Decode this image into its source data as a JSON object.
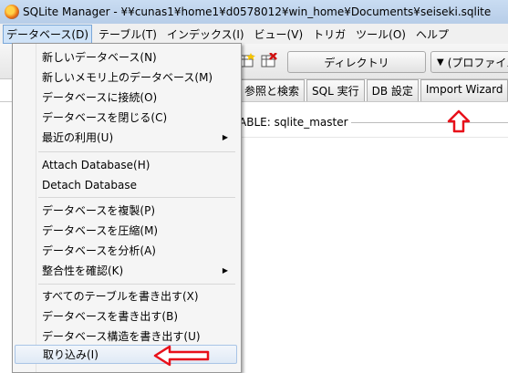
{
  "window": {
    "title": "SQLite Manager - ¥¥cunas1¥home1¥d0578012¥win_home¥Documents¥seiseki.sqlite"
  },
  "menubar": {
    "items": [
      "データベース(D)",
      "テーブル(T)",
      "インデックス(I)",
      "ビュー(V)",
      "トリガ",
      "ツール(O)",
      "ヘルプ"
    ]
  },
  "toolbar": {
    "directory_label": "ディレクトリ",
    "profile_label": "(プロファイル"
  },
  "tabs": [
    "参照と検索",
    "SQL 実行",
    "DB 設定",
    "Import Wizard"
  ],
  "content": {
    "table_caption": "ABLE: sqlite_master"
  },
  "database_menu": {
    "items": [
      {
        "label": "新しいデータベース(N)",
        "submenu": false
      },
      {
        "label": "新しいメモリ上のデータベース(M)",
        "submenu": false
      },
      {
        "label": "データベースに接続(O)",
        "submenu": false
      },
      {
        "label": "データベースを閉じる(C)",
        "submenu": false
      },
      {
        "label": "最近の利用(U)",
        "submenu": true
      },
      {
        "label": "Attach Database(H)",
        "submenu": false
      },
      {
        "label": "Detach Database",
        "submenu": false
      },
      {
        "label": "データベースを複製(P)",
        "submenu": false
      },
      {
        "label": "データベースを圧縮(M)",
        "submenu": false
      },
      {
        "label": "データベースを分析(A)",
        "submenu": false
      },
      {
        "label": "整合性を確認(K)",
        "submenu": true
      },
      {
        "label": "すべてのテーブルを書き出す(X)",
        "submenu": false
      },
      {
        "label": "データベースを書き出す(B)",
        "submenu": false
      },
      {
        "label": "データベース構造を書き出す(U)",
        "submenu": false
      },
      {
        "label": "取り込み(I)",
        "submenu": false
      }
    ],
    "submenu_arrow": "▶",
    "highlighted_item": "取り込み(I)"
  },
  "colors": {
    "annotation_arrow": "#e8101a",
    "menu_highlight": "#cfe3f8"
  }
}
